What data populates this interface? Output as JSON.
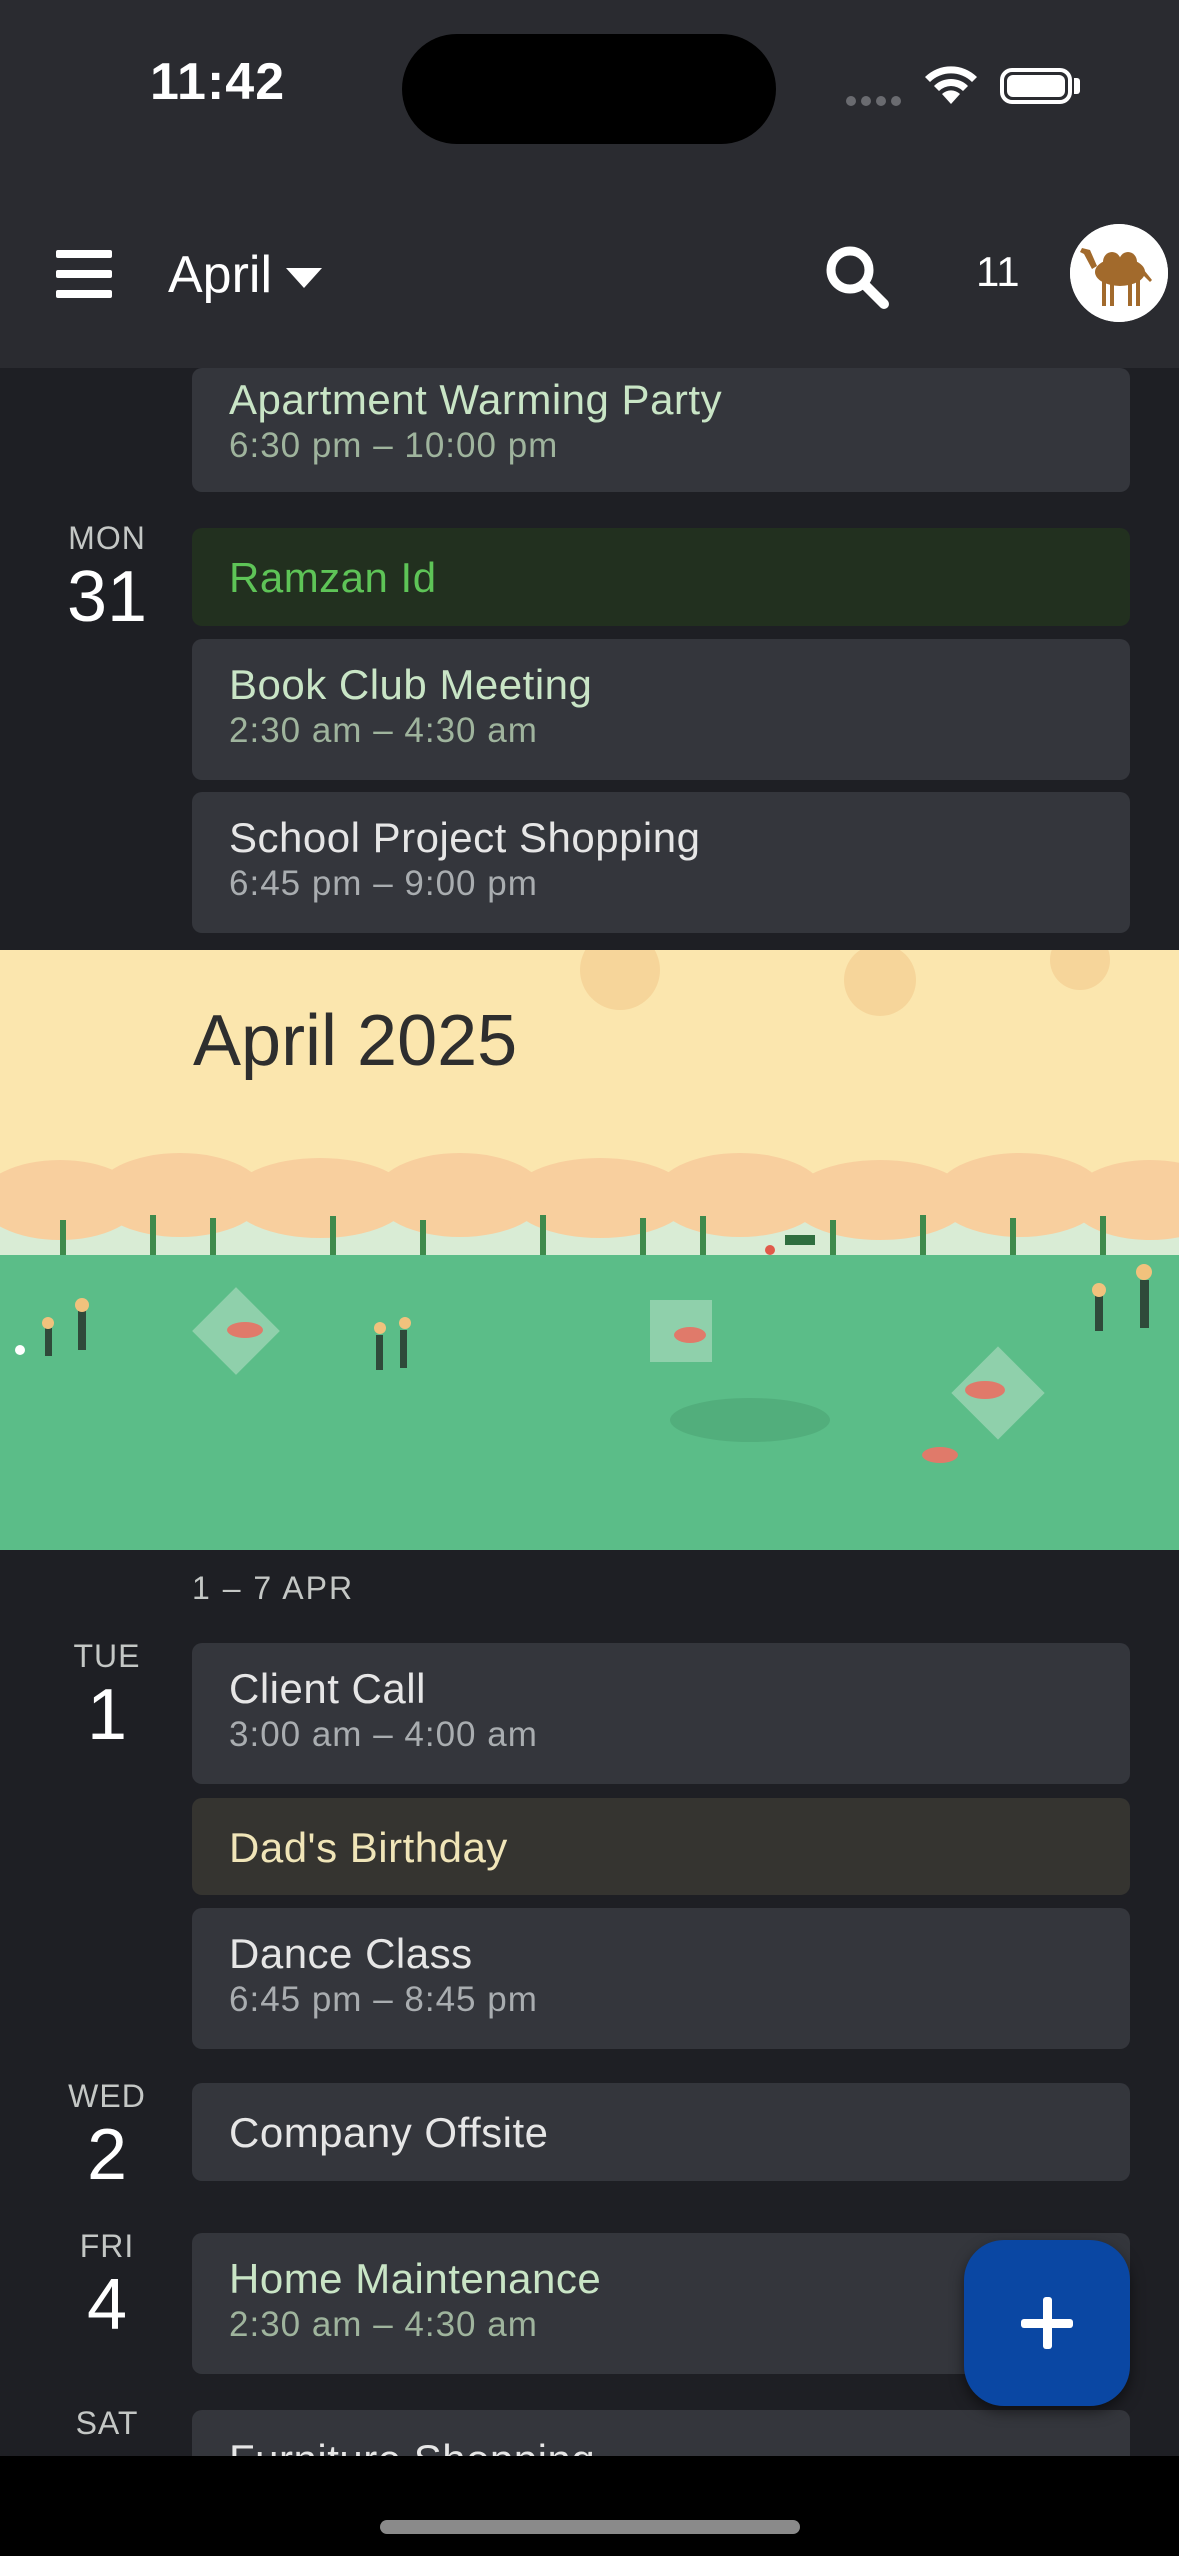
{
  "status_bar": {
    "time": "11:42"
  },
  "app_bar": {
    "month": "April",
    "notification_count": "11"
  },
  "days_before": [
    {
      "events": [
        {
          "title": "Apartment Warming Party",
          "time": "6:30 pm – 10:00 pm"
        }
      ]
    },
    {
      "dow": "MON",
      "day": "31",
      "events": [
        {
          "title": "Ramzan Id",
          "type": "holiday"
        },
        {
          "title": "Book Club Meeting",
          "time": "2:30 am – 4:30 am"
        },
        {
          "title": "School Project Shopping",
          "time": "6:45 pm – 9:00 pm"
        }
      ]
    }
  ],
  "banner": {
    "title": "April 2025"
  },
  "week": {
    "range": "1 – 7 APR",
    "days": [
      {
        "dow": "TUE",
        "day": "1",
        "events": [
          {
            "title": "Client Call",
            "time": "3:00 am – 4:00 am"
          },
          {
            "title": "Dad's Birthday",
            "type": "birthday"
          },
          {
            "title": "Dance Class",
            "time": "6:45 pm – 8:45 pm"
          }
        ]
      },
      {
        "dow": "WED",
        "day": "2",
        "events": [
          {
            "title": "Company Offsite"
          }
        ]
      },
      {
        "dow": "FRI",
        "day": "4",
        "events": [
          {
            "title": "Home Maintenance",
            "time": "2:30 am – 4:30 am"
          }
        ]
      },
      {
        "dow": "SAT",
        "events": [
          {
            "title": "Furniture Shopping"
          }
        ]
      }
    ]
  },
  "colors": {
    "background": "#1e1f24",
    "event_bg": "#34363c",
    "holiday_text": "#5ec457",
    "fab": "#0a47a3",
    "banner_sky": "#fbe6ae",
    "banner_grass": "#5bbd88"
  },
  "icons": [
    "menu-icon",
    "chevron-down-icon",
    "search-icon",
    "avatar-camel",
    "plus-icon"
  ]
}
